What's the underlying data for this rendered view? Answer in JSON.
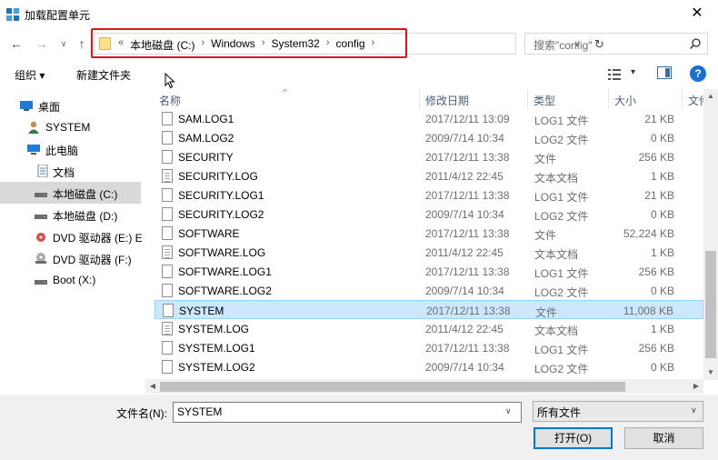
{
  "window": {
    "title": "加载配置单元",
    "close_glyph": "✕"
  },
  "address": {
    "overflow": "«",
    "crumbs": [
      "本地磁盘 (C:)",
      "Windows",
      "System32",
      "config"
    ],
    "separator": "›",
    "search_placeholder": "搜索\"config\""
  },
  "toolbar": {
    "organize": "组织 ▾",
    "new_folder": "新建文件夹",
    "view": "▾"
  },
  "nav": {
    "items": [
      {
        "label": "桌面",
        "icon": "desktop-icon"
      },
      {
        "label": "SYSTEM",
        "icon": "user-icon"
      },
      {
        "label": "此电脑",
        "icon": "computer-icon"
      },
      {
        "label": "文档",
        "icon": "document-icon"
      },
      {
        "label": "本地磁盘 (C:)",
        "icon": "drive-icon"
      },
      {
        "label": "本地磁盘 (D:)",
        "icon": "drive-icon"
      },
      {
        "label": "DVD 驱动器 (E:) E",
        "icon": "dvd-icon"
      },
      {
        "label": "DVD 驱动器 (F:)",
        "icon": "dvd-icon"
      },
      {
        "label": "Boot (X:)",
        "icon": "drive-icon"
      }
    ]
  },
  "columns": {
    "name": "名称",
    "date": "修改日期",
    "type": "类型",
    "size": "大小",
    "extra": "文件"
  },
  "files": [
    {
      "name": "SAM.LOG1",
      "date": "2017/12/11 13:09",
      "type": "LOG1 文件",
      "size": "21 KB"
    },
    {
      "name": "SAM.LOG2",
      "date": "2009/7/14 10:34",
      "type": "LOG2 文件",
      "size": "0 KB"
    },
    {
      "name": "SECURITY",
      "date": "2017/12/11 13:38",
      "type": "文件",
      "size": "256 KB"
    },
    {
      "name": "SECURITY.LOG",
      "date": "2011/4/12 22:45",
      "type": "文本文档",
      "size": "1 KB"
    },
    {
      "name": "SECURITY.LOG1",
      "date": "2017/12/11 13:38",
      "type": "LOG1 文件",
      "size": "21 KB"
    },
    {
      "name": "SECURITY.LOG2",
      "date": "2009/7/14 10:34",
      "type": "LOG2 文件",
      "size": "0 KB"
    },
    {
      "name": "SOFTWARE",
      "date": "2017/12/11 13:38",
      "type": "文件",
      "size": "52,224 KB"
    },
    {
      "name": "SOFTWARE.LOG",
      "date": "2011/4/12 22:45",
      "type": "文本文档",
      "size": "1 KB"
    },
    {
      "name": "SOFTWARE.LOG1",
      "date": "2017/12/11 13:38",
      "type": "LOG1 文件",
      "size": "256 KB"
    },
    {
      "name": "SOFTWARE.LOG2",
      "date": "2009/7/14 10:34",
      "type": "LOG2 文件",
      "size": "0 KB"
    },
    {
      "name": "SYSTEM",
      "date": "2017/12/11 13:38",
      "type": "文件",
      "size": "11,008 KB"
    },
    {
      "name": "SYSTEM.LOG",
      "date": "2011/4/12 22:45",
      "type": "文本文档",
      "size": "1 KB"
    },
    {
      "name": "SYSTEM.LOG1",
      "date": "2017/12/11 13:38",
      "type": "LOG1 文件",
      "size": "256 KB"
    },
    {
      "name": "SYSTEM.LOG2",
      "date": "2009/7/14 10:34",
      "type": "LOG2 文件",
      "size": "0 KB"
    }
  ],
  "selected_file": "SYSTEM",
  "bottom": {
    "filename_label": "文件名(N):",
    "filename_value": "SYSTEM",
    "filetype_value": "所有文件",
    "open_label": "打开(O)",
    "cancel_label": "取消"
  },
  "colors": {
    "selection": "#cce8ff",
    "accent": "#0078d7",
    "highlight_box": "#e0131a"
  }
}
